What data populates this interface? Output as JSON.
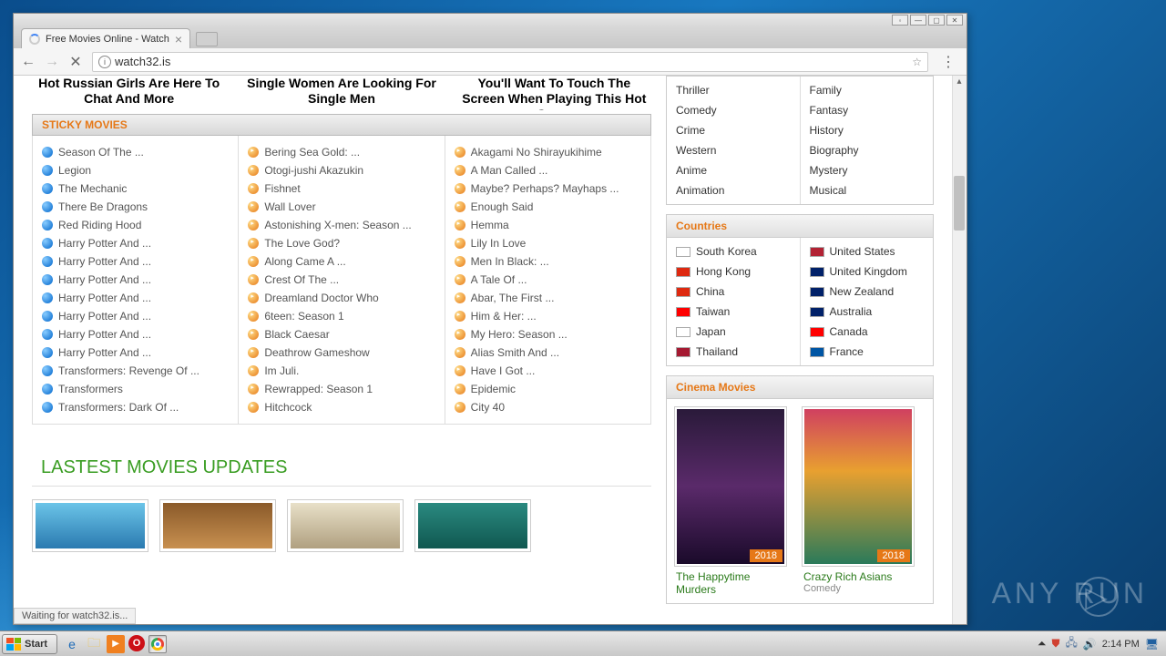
{
  "browser": {
    "tab_title": "Free Movies Online - Watch",
    "url": "watch32.is",
    "status": "Waiting for watch32.is..."
  },
  "ads": [
    "Hot Russian Girls Are Here To Chat And More",
    "Single Women Are Looking For Single Men",
    "You'll Want To Touch The Screen When Playing This Hot Game"
  ],
  "sticky": {
    "header": "STICKY MOVIES",
    "col1": [
      "Season Of The ...",
      "Legion",
      "The Mechanic",
      "There Be Dragons",
      "Red Riding Hood",
      "Harry Potter And ...",
      "Harry Potter And ...",
      "Harry Potter And ...",
      "Harry Potter And ...",
      "Harry Potter And ...",
      "Harry Potter And ...",
      "Harry Potter And ...",
      "Transformers: Revenge Of ...",
      "Transformers",
      "Transformers: Dark Of ..."
    ],
    "col2": [
      "Bering Sea Gold: ...",
      "Otogi-jushi Akazukin",
      "Fishnet",
      "Wall Lover",
      "Astonishing X-men: Season ...",
      "The Love God?",
      "Along Came A ...",
      "Crest Of The ...",
      "Dreamland Doctor Who",
      "6teen: Season 1",
      "Black Caesar",
      "Deathrow Gameshow",
      "Im Juli.",
      "Rewrapped: Season 1",
      "Hitchcock"
    ],
    "col3": [
      "Akagami No Shirayukihime",
      "A Man Called ...",
      "Maybe? Perhaps? Mayhaps ...",
      "Enough Said",
      "Hemma",
      "Lily In Love",
      "Men In Black: ...",
      "A Tale Of ...",
      "Abar, The First ...",
      "Him & Her: ...",
      "My Hero: Season ...",
      "Alias Smith And ...",
      "Have I Got ...",
      "Epidemic",
      "City 40"
    ]
  },
  "latest_header": "LASTEST MOVIES UPDATES",
  "genres": {
    "col1": [
      "Thriller",
      "Comedy",
      "Crime",
      "Western",
      "Anime",
      "Animation"
    ],
    "col2": [
      "Family",
      "Fantasy",
      "History",
      "Biography",
      "Mystery",
      "Musical"
    ]
  },
  "countries": {
    "header": "Countries",
    "col1": [
      {
        "name": "South Korea",
        "flag": "#fff"
      },
      {
        "name": "Hong Kong",
        "flag": "#de2910"
      },
      {
        "name": "China",
        "flag": "#de2910"
      },
      {
        "name": "Taiwan",
        "flag": "#fe0000"
      },
      {
        "name": "Japan",
        "flag": "#fff"
      },
      {
        "name": "Thailand",
        "flag": "#a51931"
      }
    ],
    "col2": [
      {
        "name": "United States",
        "flag": "#b22234"
      },
      {
        "name": "United Kingdom",
        "flag": "#012169"
      },
      {
        "name": "New Zealand",
        "flag": "#012169"
      },
      {
        "name": "Australia",
        "flag": "#012169"
      },
      {
        "name": "Canada",
        "flag": "#ff0000"
      },
      {
        "name": "France",
        "flag": "#0055a4"
      }
    ]
  },
  "cinema": {
    "header": "Cinema Movies",
    "items": [
      {
        "title": "The Happytime Murders",
        "year": "2018",
        "genre": ""
      },
      {
        "title": "Crazy Rich Asians",
        "year": "2018",
        "genre": "Comedy"
      }
    ]
  },
  "taskbar": {
    "start": "Start",
    "time": "2:14 PM"
  },
  "watermark": "ANY       RUN"
}
